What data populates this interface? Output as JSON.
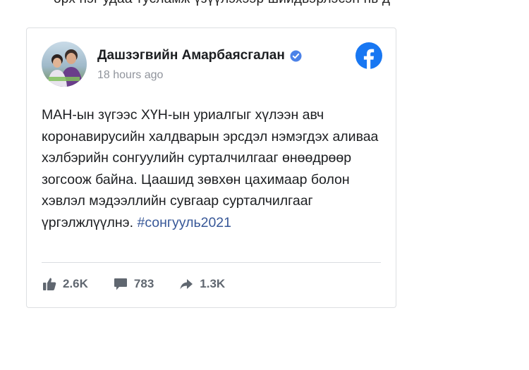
{
  "top_text": "өрх нэг удаа тусламж үзүүлэхээр шийдвэрлэсэн нь д",
  "post": {
    "author": "Дашзэгвийн Амарбаясгалан",
    "timestamp": "18 hours ago",
    "text": "МАН-ын зүгээс ХҮН-ын уриалгыг хүлээн авч коронавирусийн халдварын эрсдэл нэмэгдэх аливаа хэлбэрийн сонгуулийн сурталчилгааг өнөөдрөөр зогсоож байна. Цаашид зөвхөн цахимаар болон хэвлэл мэдээллийн сувгаар сурталчилгааг үргэлжлүүлнэ.",
    "hashtag": "#сонгууль2021",
    "icons": {
      "verified": "verified-badge-icon",
      "platform": "facebook-icon"
    }
  },
  "stats": {
    "likes": "2.6K",
    "comments": "783",
    "shares": "1.3K"
  },
  "colors": {
    "facebook_blue": "#1877f2",
    "link": "#385898",
    "muted": "#606770",
    "border": "#dddfe2"
  }
}
